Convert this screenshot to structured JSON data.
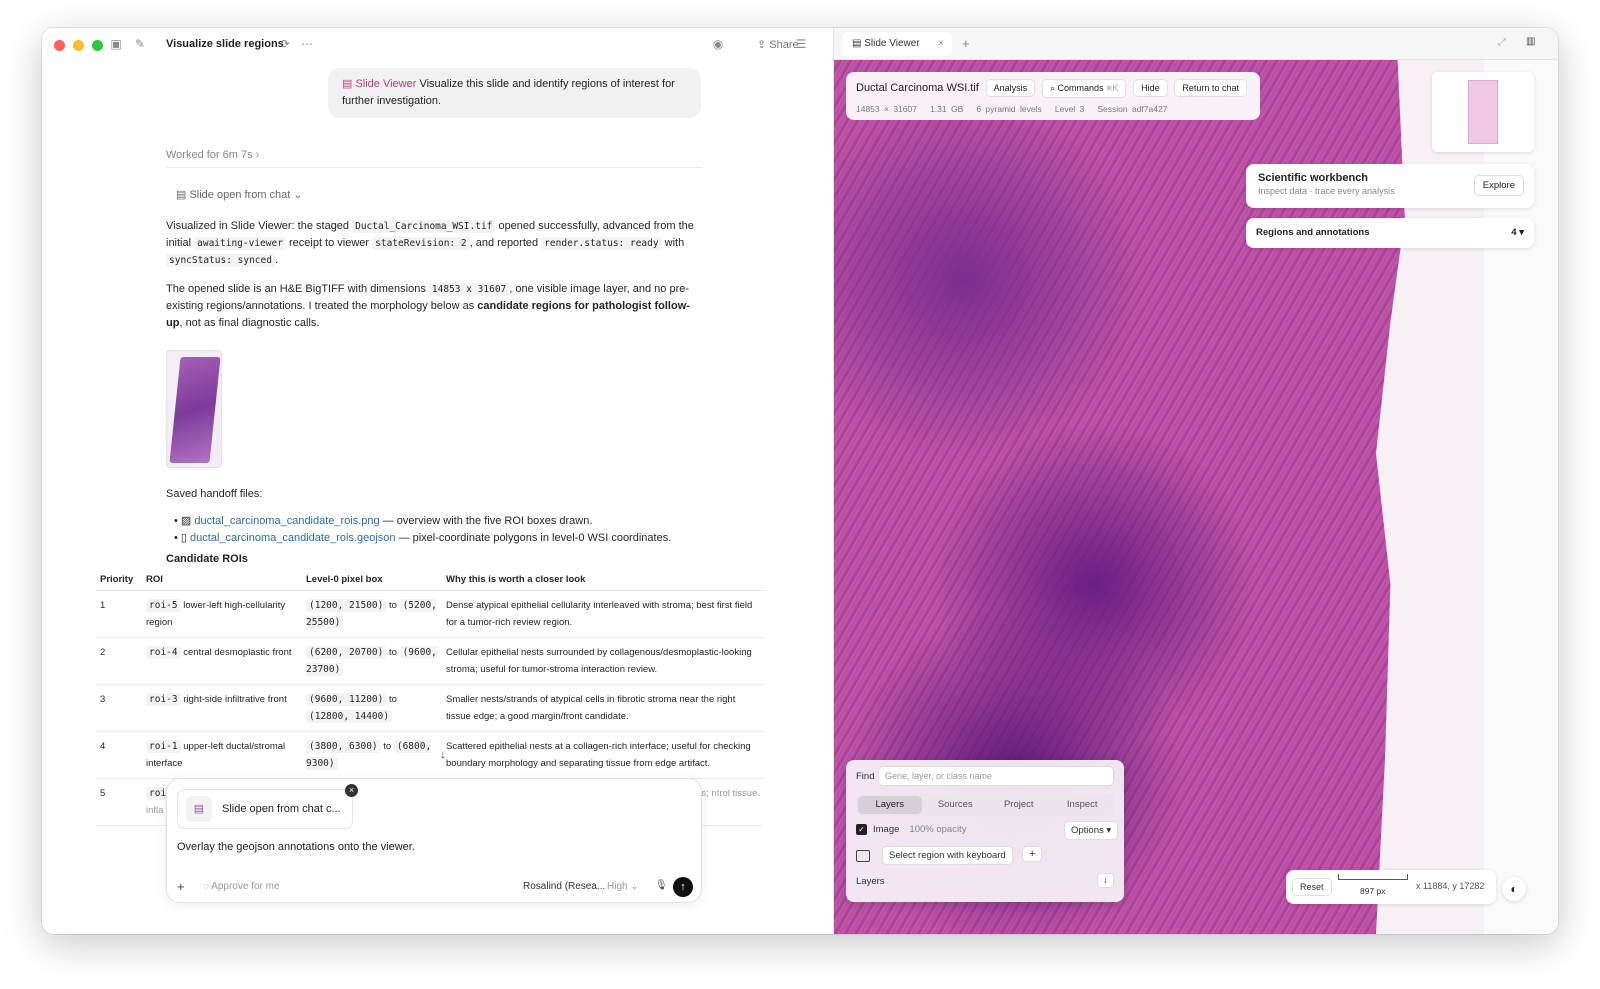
{
  "window": {
    "title": "Visualize slide regions",
    "share_label": "Share",
    "colors": {
      "close": "#ff5f57",
      "minimize": "#febc2e",
      "zoom": "#28c840",
      "accent": "#b5407a",
      "link": "#2b6cb0"
    }
  },
  "chat": {
    "user_message_tag": "Slide Viewer",
    "user_message": "Visualize this slide and identify regions of interest for further investigation.",
    "worked_for": "Worked for 6m 7s",
    "slide_open": "Slide open from chat",
    "p1": {
      "a": "Visualized in Slide Viewer: the staged ",
      "code1": "Ductal_Carcinoma_WSI.tif",
      "b": " opened successfully, advanced from the initial ",
      "code2": "awaiting-viewer",
      "c": " receipt to viewer ",
      "code3": "stateRevision: 2",
      "d": ", and reported ",
      "code4": "render.status: ready",
      "e": " with ",
      "code5": "syncStatus: synced",
      "f": "."
    },
    "p2": {
      "a": "The opened slide is an H&E BigTIFF with dimensions ",
      "code1": "14853 x 31607",
      "b": ", one visible image layer, and no pre-existing regions/annotations. I treated the morphology below as ",
      "bold": "candidate regions for pathologist follow-up",
      "c": ", not as final diagnostic calls."
    },
    "saved_label": "Saved handoff files:",
    "files": [
      {
        "name": "ductal_carcinoma_candidate_rois.png",
        "desc": " — overview with the five ROI boxes drawn."
      },
      {
        "name": "ductal_carcinoma_candidate_rois.geojson",
        "desc": " — pixel-coordinate polygons in level-0 WSI coordinates."
      }
    ],
    "roi_title": "Candidate ROIs",
    "roi_headers": [
      "Priority",
      "ROI",
      "Level-0 pixel box",
      "Why this is worth a closer look"
    ],
    "rois": [
      {
        "priority": "1",
        "id": "roi-5",
        "name": "lower-left high-cellularity region",
        "box1": "(1200, 21500)",
        "to": "to",
        "box2": "(5200, 25500)",
        "why": "Dense atypical epithelial cellularity interleaved with stroma; best first field for a tumor-rich review region."
      },
      {
        "priority": "2",
        "id": "roi-4",
        "name": "central desmoplastic front",
        "box1": "(6200, 20700)",
        "to": "to",
        "box2": "(9600, 23700)",
        "why": "Cellular epithelial nests surrounded by collagenous/desmoplastic-looking stroma; useful for tumor-stroma interaction review."
      },
      {
        "priority": "3",
        "id": "roi-3",
        "name": "right-side infiltrative front",
        "box1": "(9600, 11200)",
        "to": "to",
        "box2": "(12800, 14400)",
        "why": "Smaller nests/strands of atypical cells in fibrotic stroma near the right tissue edge; a good margin/front candidate."
      },
      {
        "priority": "4",
        "id": "roi-1",
        "name": "upper-left ductal/stromal interface",
        "box1": "(3800, 6300)",
        "to": "to",
        "box2": "(6800, 9300)",
        "why": "Scattered epithelial nests at a collagen-rich interface; useful for checking boundary morphology and separating tissue from edge artifact."
      },
      {
        "priority": "5",
        "id": "roi",
        "name": "infla",
        "box1": "",
        "to": "",
        "box2": "",
        "why": "mmatory cells; ntrol tissue."
      }
    ],
    "composer": {
      "chip_label": "Slide open from chat c...",
      "text": "Overlay the geojson annotations onto the viewer.",
      "approve": "Approve for me",
      "model": "Rosalind (Resea...",
      "effort": "High"
    }
  },
  "viewer": {
    "tab_label": "Slide Viewer",
    "file_name": "Ductal Carcinoma WSI.tif",
    "btn_analysis": "Analysis",
    "btn_commands": "Commands",
    "cmd_shortcut": "⌘K",
    "btn_hide": "Hide",
    "btn_return": "Return to chat",
    "meta": [
      "14853 × 31607",
      "1.31 GB",
      "6 pyramid levels",
      "Level 3",
      "Session adf7a427"
    ],
    "workbench_title": "Scientific workbench",
    "workbench_sub": "Inspect data · trace every analysis",
    "explore": "Explore",
    "regions_label": "Regions and annotations",
    "regions_count": "4",
    "find_label": "Find",
    "find_placeholder": "Gene, layer, or class name",
    "tabs": [
      "Layers",
      "Sources",
      "Project",
      "Inspect"
    ],
    "image_label": "Image",
    "opacity": "100% opacity",
    "options": "Options",
    "select_region": "Select region with keyboard",
    "layers_footer": "Layers",
    "reset": "Reset",
    "scale": "897 px",
    "coords": "x 11884, y 17282"
  }
}
